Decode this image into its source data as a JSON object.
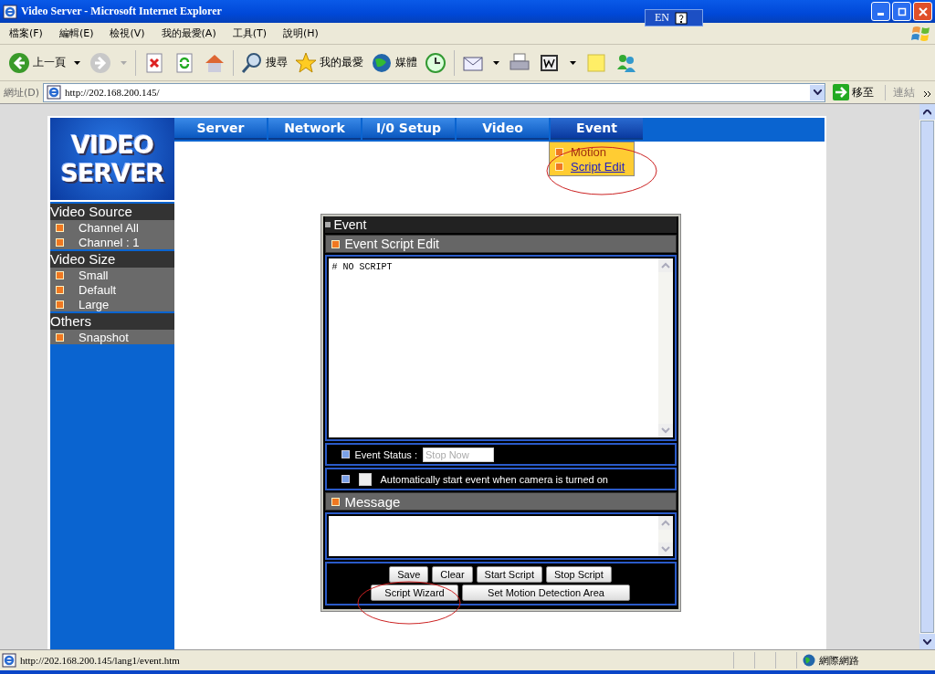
{
  "window": {
    "title": "Video Server - Microsoft Internet Explorer",
    "ime": "EN"
  },
  "menu": [
    "檔案(F)",
    "編輯(E)",
    "檢視(V)",
    "我的最愛(A)",
    "工具(T)",
    "說明(H)"
  ],
  "toolbar": [
    {
      "kind": "back",
      "label": "上一頁",
      "disabled": false
    },
    {
      "kind": "forward",
      "disabled": true
    },
    {
      "kind": "stop"
    },
    {
      "kind": "refresh"
    },
    {
      "kind": "home"
    },
    {
      "kind": "search",
      "label": "搜尋"
    },
    {
      "kind": "favorites",
      "label": "我的最愛"
    },
    {
      "kind": "media",
      "label": "媒體"
    },
    {
      "kind": "history"
    },
    {
      "kind": "mail"
    },
    {
      "kind": "print"
    },
    {
      "kind": "word"
    },
    {
      "kind": "note"
    },
    {
      "kind": "messenger"
    }
  ],
  "address": {
    "label": "網址(D)",
    "url": "http://202.168.200.145/",
    "go": "移至",
    "links": "連結"
  },
  "nav_tabs": [
    {
      "label": "Server",
      "selected": false
    },
    {
      "label": "Network",
      "selected": false
    },
    {
      "label": "I/0 Setup",
      "selected": false
    },
    {
      "label": "Video",
      "selected": false
    },
    {
      "label": "Event",
      "selected": true
    }
  ],
  "dropdown": [
    {
      "label": "Motion",
      "hovered": false
    },
    {
      "label": "Script Edit",
      "hovered": true
    }
  ],
  "logo": [
    "VIDEO",
    "SERVER"
  ],
  "sidebar": [
    {
      "title": "Video Source",
      "items": [
        "Channel All",
        "Channel : 1"
      ]
    },
    {
      "title": "Video Size",
      "items": [
        "Small",
        "Default",
        "Large"
      ]
    },
    {
      "title": "Others",
      "items": [
        "Snapshot"
      ]
    }
  ],
  "panel": {
    "title": "Event",
    "script_section": "Event Script Edit",
    "script": "# NO SCRIPT",
    "status_label": "Event Status :",
    "status_value": "Stop Now",
    "auto_start": {
      "label": "Automatically start event when camera is turned on",
      "checked": false
    },
    "message_section": "Message",
    "buttons_row1": [
      "Save",
      "Clear",
      "Start Script",
      "Stop Script"
    ],
    "buttons_row2": [
      "Script Wizard",
      "Set Motion Detection Area"
    ]
  },
  "status_bar": {
    "text": "http://202.168.200.145/lang1/event.htm",
    "zone": "網際網路"
  }
}
